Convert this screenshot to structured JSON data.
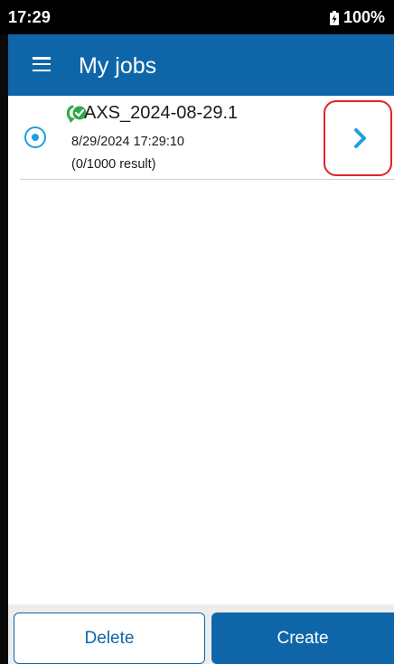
{
  "status_bar": {
    "time": "17:29",
    "battery": "100%",
    "battery_icon": "battery-charging-icon"
  },
  "app_bar": {
    "menu_icon": "hamburger-menu-icon",
    "title": "My jobs",
    "color": "#0e66a8"
  },
  "jobs": [
    {
      "name": "AXS_2024-08-29.1",
      "date": "8/29/2024 17:29:10",
      "results": "(0/1000 result)",
      "selected": true,
      "sync_icon": "sync-check-icon",
      "open_icon": "chevron-right-icon"
    }
  ],
  "bottom_bar": {
    "delete_label": "Delete",
    "create_label": "Create"
  },
  "colors": {
    "primary": "#0e66a8",
    "radio": "#1ea0df",
    "chevron": "#1ea0df",
    "highlight": "#e1232a",
    "sync_green": "#2ea84a"
  }
}
